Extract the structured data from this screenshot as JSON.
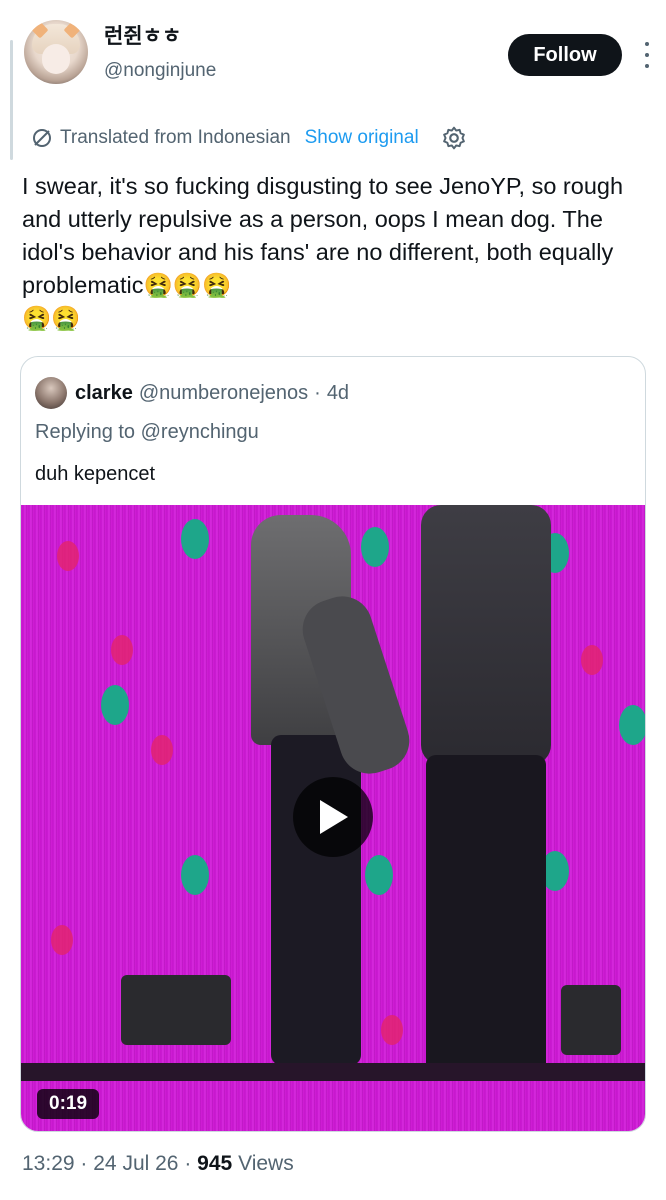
{
  "author": {
    "display_name": "런쥔ㅎㅎ",
    "handle": "@nonginjune"
  },
  "follow_label": "Follow",
  "translation": {
    "text": "Translated from Indonesian",
    "show_original": "Show original"
  },
  "tweet": {
    "text": "I swear, it's so fucking disgusting to see JenoYP, so rough and utterly repulsive as a person, oops I mean dog. The idol's behavior and his fans' are no different, both equally problematic🤮🤮🤮\n🤮🤮"
  },
  "quote": {
    "name": "clarke",
    "handle": "@numberonejenos",
    "separator": "·",
    "time": "4d",
    "replying_prefix": "Replying to",
    "replying_to": "@reynchingu",
    "text": "duh kepencet",
    "video": {
      "duration": "0:19"
    }
  },
  "footer": {
    "time": "13:29",
    "separator": "·",
    "date": "24 Jul 26",
    "views_count": "945",
    "views_label": "Views"
  },
  "colors": {
    "link": "#1d9bf0",
    "secondary_text": "#536471",
    "primary_text": "#0f1419",
    "video_background": "#d21fd6"
  },
  "icons": [
    "translate-icon",
    "gear-icon",
    "more-icon",
    "play-icon"
  ]
}
